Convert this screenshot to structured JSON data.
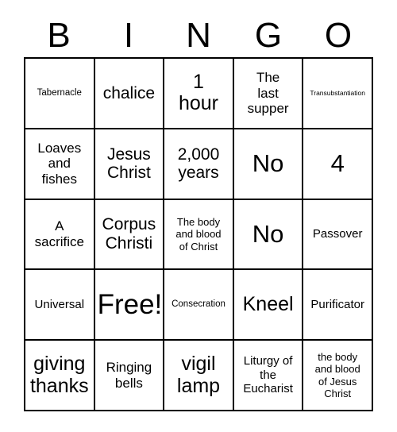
{
  "card": {
    "type": "bingo-card",
    "header_letters": [
      "B",
      "I",
      "N",
      "G",
      "O"
    ],
    "columns": 5,
    "rows": 5,
    "colors": {
      "background": "#ffffff",
      "text": "#000000",
      "grid_line": "#000000"
    },
    "cells": [
      {
        "text": "Tabernacle",
        "size": "s"
      },
      {
        "text": "chalice",
        "size": "l"
      },
      {
        "text": "1\nhour",
        "size": "xl"
      },
      {
        "text": "The\nlast\nsupper",
        "size": "ml"
      },
      {
        "text": "Transubstantiation",
        "size": "xs"
      },
      {
        "text": "Loaves\nand\nfishes",
        "size": "ml"
      },
      {
        "text": "Jesus\nChrist",
        "size": "l"
      },
      {
        "text": "2,000\nyears",
        "size": "l"
      },
      {
        "text": "No",
        "size": "xxl"
      },
      {
        "text": "4",
        "size": "xxl"
      },
      {
        "text": "A\nsacrifice",
        "size": "ml"
      },
      {
        "text": "Corpus\nChristi",
        "size": "l"
      },
      {
        "text": "The body\nand blood\nof Christ",
        "size": "sm"
      },
      {
        "text": "No",
        "size": "xxl"
      },
      {
        "text": "Passover",
        "size": "m"
      },
      {
        "text": "Universal",
        "size": "m"
      },
      {
        "text": "Free!",
        "size": "huge"
      },
      {
        "text": "Consecration",
        "size": "s"
      },
      {
        "text": "Kneel",
        "size": "xl"
      },
      {
        "text": "Purificator",
        "size": "m"
      },
      {
        "text": "giving\nthanks",
        "size": "xl"
      },
      {
        "text": "Ringing\nbells",
        "size": "ml"
      },
      {
        "text": "vigil\nlamp",
        "size": "xl"
      },
      {
        "text": "Liturgy of\nthe\nEucharist",
        "size": "m"
      },
      {
        "text": "the body\nand blood\nof Jesus\nChrist",
        "size": "sm"
      }
    ]
  }
}
